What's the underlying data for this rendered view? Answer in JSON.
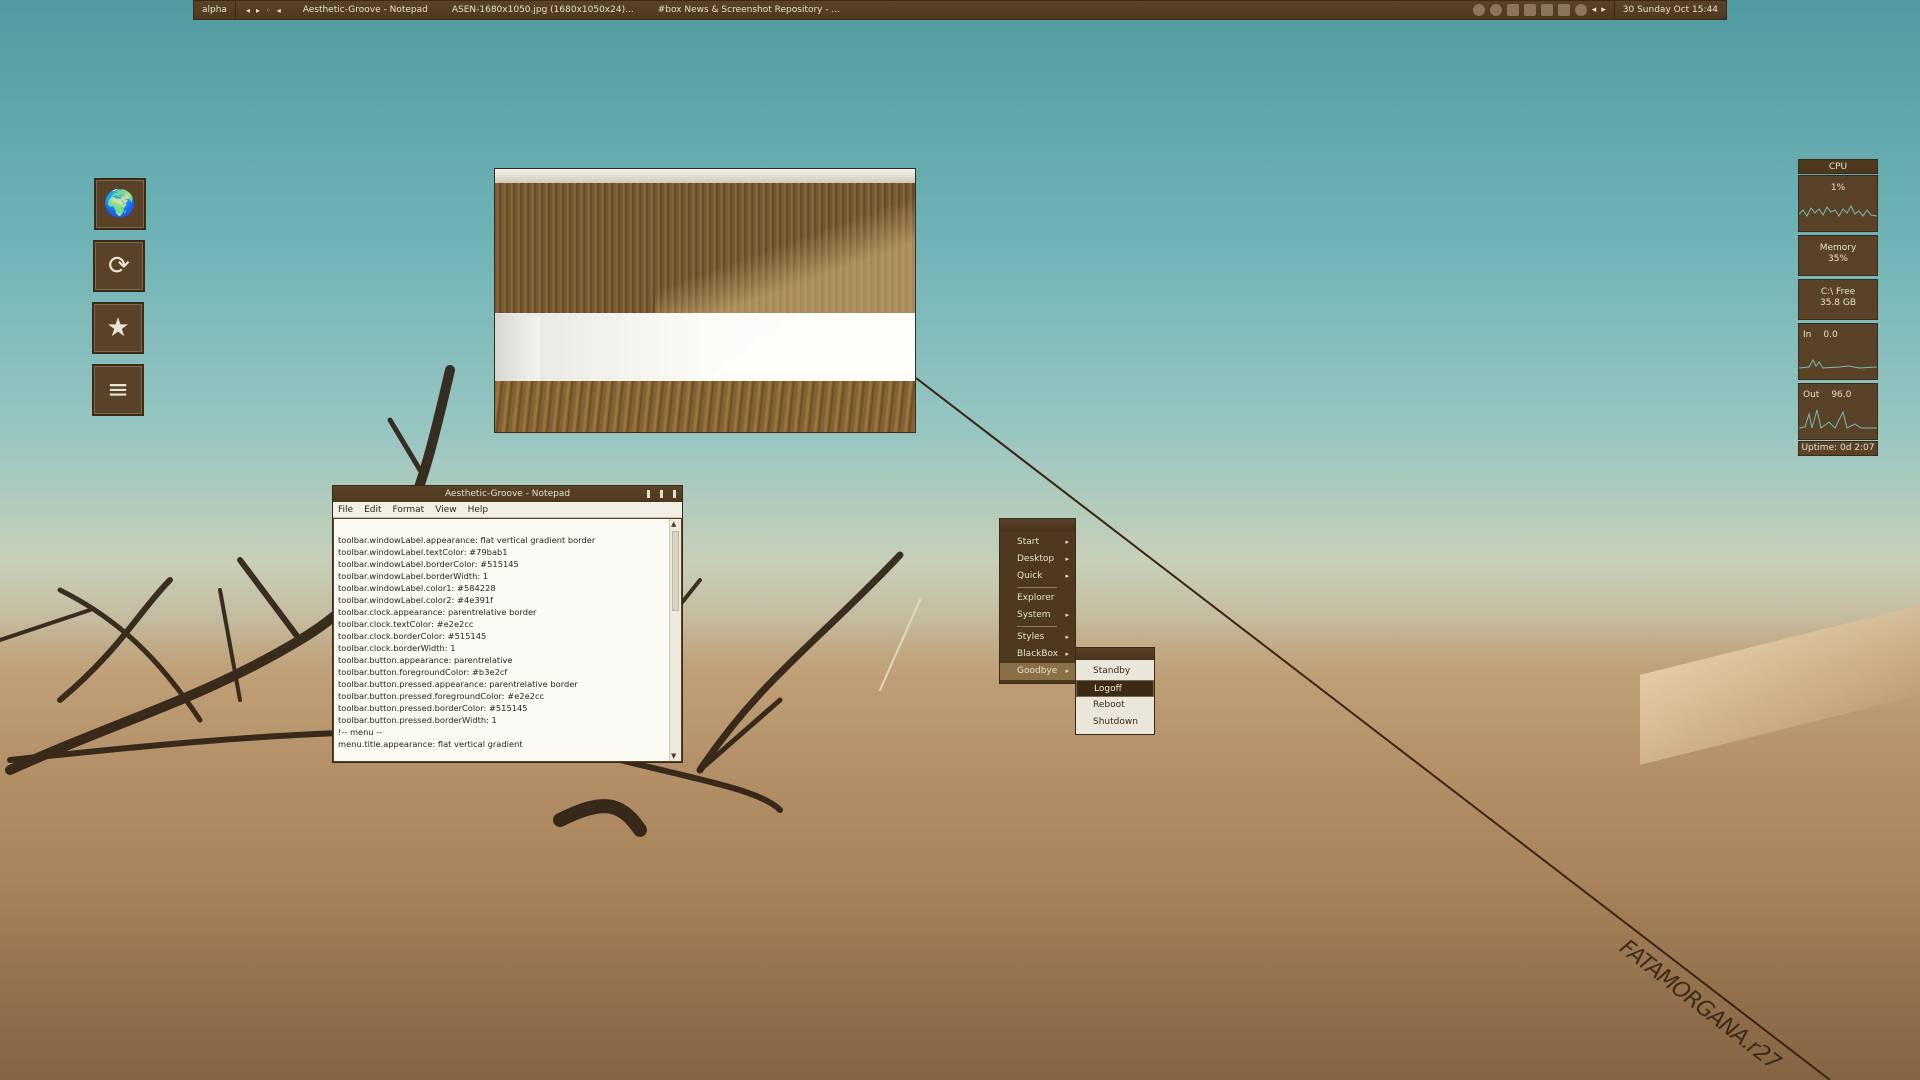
{
  "toolbar": {
    "workspace": "alpha",
    "nav_arrows": [
      "◂",
      "▸",
      "◦",
      "◂"
    ],
    "tasks": [
      "Aesthetic-Groove - Notepad",
      "ASEN-1680x1050.jpg (1680x1050x24)...",
      "#box News & Screenshot Repository - ..."
    ],
    "tray_icons": [
      "globe-icon",
      "drop-icon",
      "network-icon",
      "bars-icon",
      "chart-icon",
      "speaker-icon",
      "refresh-icon"
    ],
    "tray_arrows": [
      "◂",
      "▸"
    ],
    "clock": "30 Sunday Oct 15:44"
  },
  "desktop_icons": [
    {
      "name": "globe-icon",
      "glyph": "🌍"
    },
    {
      "name": "sync-icon",
      "glyph": "⟳"
    },
    {
      "name": "favorites-icon",
      "glyph": "★"
    },
    {
      "name": "document-icon",
      "glyph": "≡"
    }
  ],
  "notepad": {
    "title": "Aesthetic-Groove - Notepad",
    "menu": [
      "File",
      "Edit",
      "Format",
      "View",
      "Help"
    ],
    "lines": [
      "toolbar.windowLabel.appearance: flat vertical gradient border",
      "toolbar.windowLabel.textColor: #79bab1",
      "toolbar.windowLabel.borderColor: #515145",
      "toolbar.windowLabel.borderWidth: 1",
      "toolbar.windowLabel.color1: #584228",
      "toolbar.windowLabel.color2: #4e391f",
      "toolbar.clock.appearance: parentrelative border",
      "toolbar.clock.textColor: #e2e2cc",
      "toolbar.clock.borderColor: #515145",
      "toolbar.clock.borderWidth: 1",
      "toolbar.button.appearance: parentrelative",
      "toolbar.button.foregroundColor: #b3e2cf",
      "toolbar.button.pressed.appearance: parentrelative border",
      "toolbar.button.pressed.foregroundColor: #e2e2cc",
      "toolbar.button.pressed.borderColor: #515145",
      "toolbar.button.pressed.borderWidth: 1",
      "",
      "!-- menu --",
      "menu.title.appearance: flat vertical gradient"
    ]
  },
  "root_menu": {
    "items": [
      {
        "label": "Start",
        "submenu": true
      },
      {
        "label": "Desktop",
        "submenu": true
      },
      {
        "label": "Quick",
        "submenu": true
      },
      {
        "sep": true
      },
      {
        "label": "Explorer",
        "submenu": false
      },
      {
        "label": "System",
        "submenu": true
      },
      {
        "sep": true
      },
      {
        "label": "Styles",
        "submenu": true
      },
      {
        "label": "BlackBox",
        "submenu": true
      },
      {
        "label": "Goodbye",
        "submenu": true,
        "active": true
      }
    ]
  },
  "goodbye_menu": {
    "items": [
      {
        "label": "Standby"
      },
      {
        "label": "Logoff",
        "selected": true
      },
      {
        "label": "Reboot"
      },
      {
        "label": "Shutdown"
      }
    ]
  },
  "monitor": {
    "cpu_label": "CPU",
    "cpu_value": "1%",
    "memory_label": "Memory",
    "memory_value": "35%",
    "disk_label": "C:\\ Free",
    "disk_value": "35.8 GB",
    "net_in_label": "In",
    "net_in_value": "0.0",
    "net_out_label": "Out",
    "net_out_value": "96.0",
    "uptime": "Uptime: 0d 2:07"
  },
  "watermark": "FATAMORGANA.r27",
  "colors": {
    "bar_dark": "#4e391f",
    "bar_light": "#5a4228",
    "text": "#e2e2cc",
    "border": "#3c2a17"
  }
}
